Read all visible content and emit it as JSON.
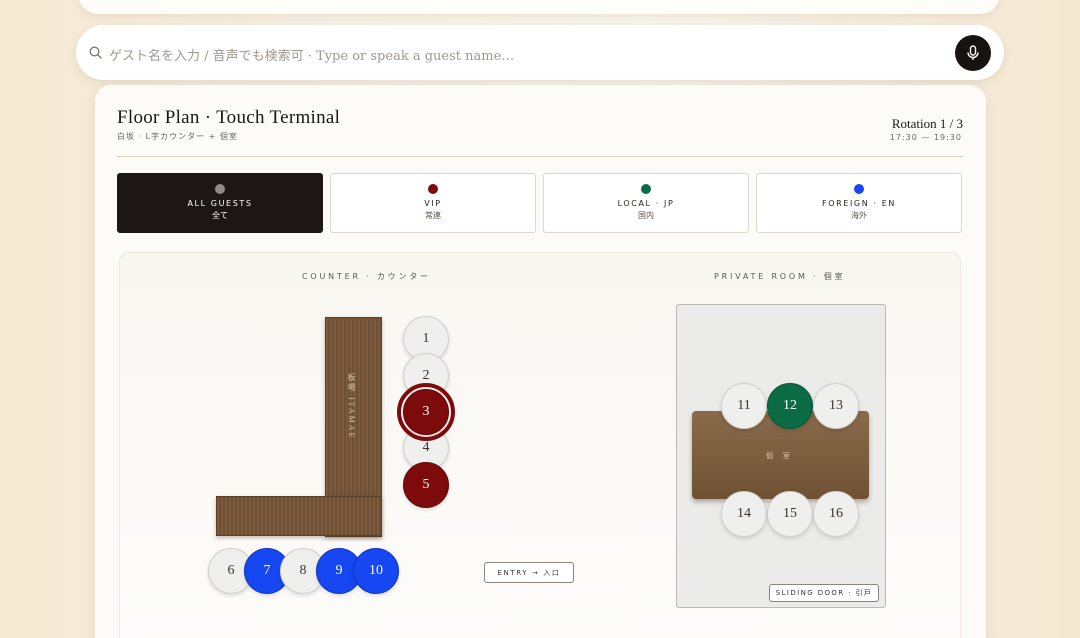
{
  "search": {
    "placeholder": "ゲスト名を入力 / 音声でも検索可 · Type or speak a guest name…"
  },
  "header": {
    "title": "Floor Plan · Touch Terminal",
    "subtitle": "白坂 · L字カウンター + 個室",
    "rotation": "Rotation 1 / 3",
    "time": "17:30 — 19:30"
  },
  "filters": [
    {
      "label": "ALL GUESTS",
      "sub": "全て",
      "dot_color": "#8f8b86",
      "active": true
    },
    {
      "label": "VIP",
      "sub": "常連",
      "dot_color": "#7e0b0b",
      "active": false
    },
    {
      "label": "LOCAL · JP",
      "sub": "国内",
      "dot_color": "#0b6b45",
      "active": false
    },
    {
      "label": "FOREIGN · EN",
      "sub": "海外",
      "dot_color": "#1747f2",
      "active": false
    }
  ],
  "counter": {
    "section_label": "COUNTER · カウンター",
    "itamae_label": "板場 ITAMAE"
  },
  "private_room": {
    "section_label": "PRIVATE ROOM · 個室",
    "table_label": "個 室",
    "door_label": "SLIDING DOOR · 引戸"
  },
  "entry_label": "ENTRY → 入口",
  "seats": [
    {
      "num": "1",
      "status": "empty"
    },
    {
      "num": "2",
      "status": "empty"
    },
    {
      "num": "3",
      "status": "vip",
      "selected": true
    },
    {
      "num": "4",
      "status": "empty"
    },
    {
      "num": "5",
      "status": "vip"
    },
    {
      "num": "6",
      "status": "empty"
    },
    {
      "num": "7",
      "status": "foreign"
    },
    {
      "num": "8",
      "status": "empty"
    },
    {
      "num": "9",
      "status": "foreign"
    },
    {
      "num": "10",
      "status": "foreign"
    },
    {
      "num": "11",
      "status": "empty"
    },
    {
      "num": "12",
      "status": "local"
    },
    {
      "num": "13",
      "status": "empty"
    },
    {
      "num": "14",
      "status": "empty"
    },
    {
      "num": "15",
      "status": "empty"
    },
    {
      "num": "16",
      "status": "empty"
    }
  ]
}
